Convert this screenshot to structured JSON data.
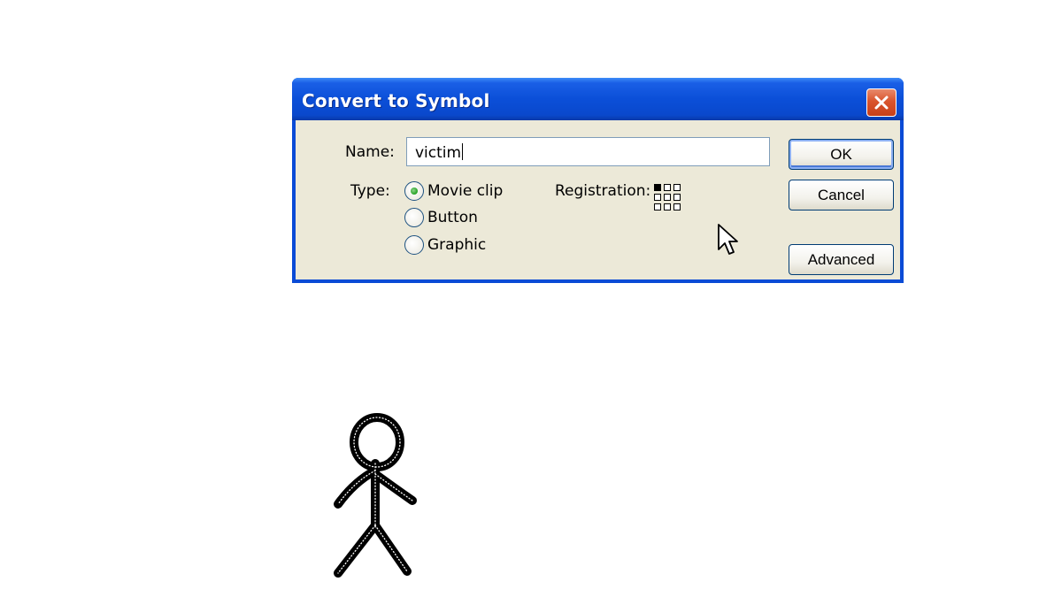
{
  "dialog": {
    "title": "Convert to Symbol",
    "name_label": "Name:",
    "name_value": "victim",
    "type_label": "Type:",
    "type_options": [
      "Movie clip",
      "Button",
      "Graphic"
    ],
    "selected_type": "Movie clip",
    "registration_label": "Registration:",
    "registration_selected": "top-left",
    "buttons": {
      "ok": "OK",
      "cancel": "Cancel",
      "advanced": "Advanced"
    }
  },
  "icons": {
    "close": "close-icon",
    "cursor": "mouse-pointer-icon",
    "registration": "registration-grid-icon"
  },
  "colors": {
    "titlebar": "#0a4bd6",
    "dialog_bg": "#ece9d8",
    "close_button": "#d9542c",
    "radio_selected": "#21a121"
  }
}
